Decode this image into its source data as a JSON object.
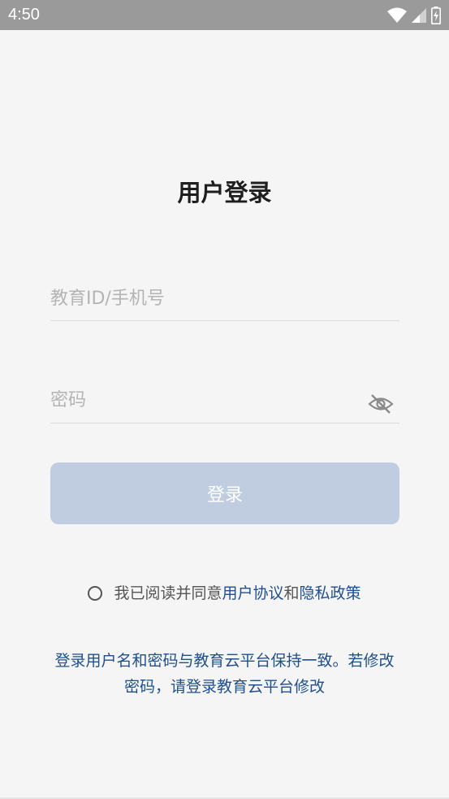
{
  "status_bar": {
    "time": "4:50",
    "icons": [
      "wifi-icon",
      "cellular-signal-icon",
      "battery-charging-icon"
    ]
  },
  "login": {
    "title": "用户登录",
    "account_placeholder": "教育ID/手机号",
    "password_placeholder": "密码",
    "login_label": "登录"
  },
  "agreement": {
    "prefix": "我已阅读并同意",
    "user_agreement": "用户协议",
    "conjunction": "和",
    "privacy_policy": "隐私政策"
  },
  "notice": {
    "line1": "登录用户名和密码与教育云平台保持一致。若修改",
    "line2": "密码，请登录教育云平台修改"
  },
  "colors": {
    "accent": "#1f4f8f",
    "button_disabled": "#c0cde0",
    "status_bar": "#9a9a9a",
    "background": "#f5f5f5"
  }
}
